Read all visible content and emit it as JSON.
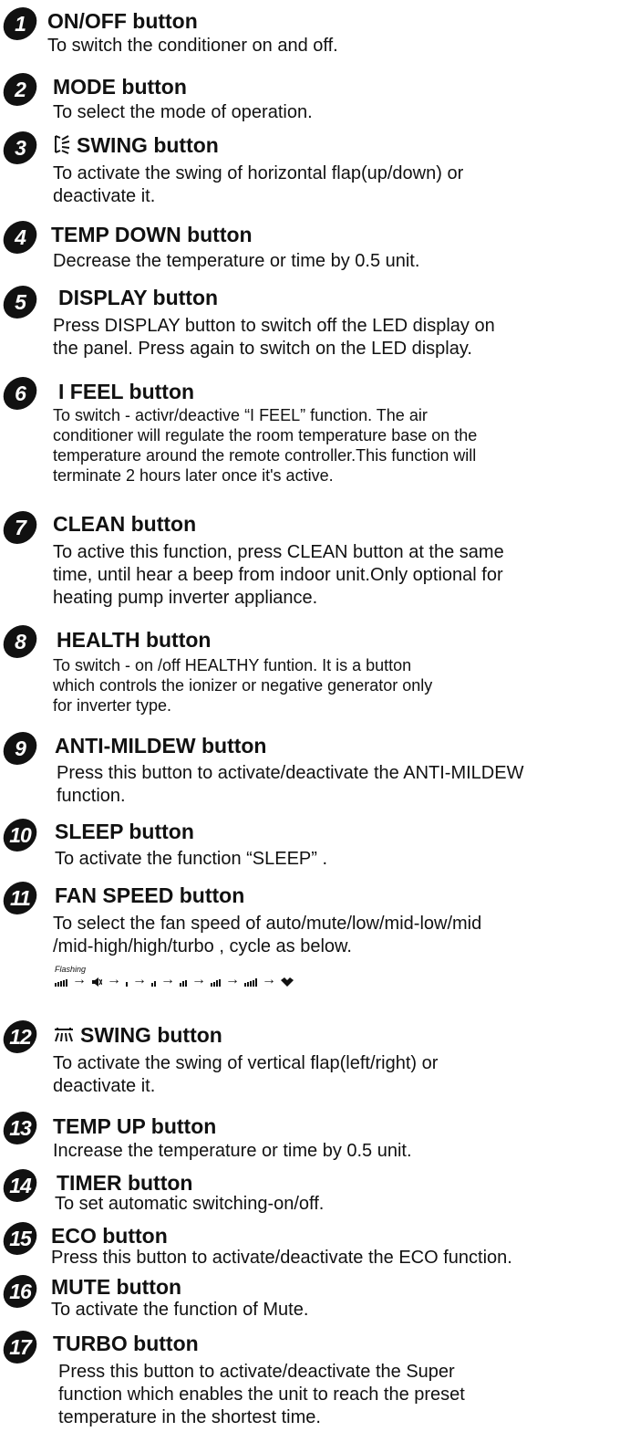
{
  "items": [
    {
      "num": "1",
      "title": "ON/OFF button",
      "lines": [
        "To switch the conditioner on and off."
      ]
    },
    {
      "num": "2",
      "title": "MODE  button",
      "lines": [
        "To select the  mode of operation."
      ]
    },
    {
      "num": "3",
      "title": "SWING  button",
      "lines": [
        "To activate the swing of horizontal flap(up/down) or",
        "deactivate it."
      ]
    },
    {
      "num": "4",
      "title": "TEMP DOWN button",
      "lines": [
        "Decrease the temperature or time by 0.5 unit."
      ]
    },
    {
      "num": "5",
      "title": "DISPLAY  button",
      "lines": [
        "Press   DISPLAY   button to switch off the LED display on",
        "the panel. Press again to switch on the LED display."
      ]
    },
    {
      "num": "6",
      "title": "I FEEL  button",
      "lines": [
        "To switch - activr/deactive “I FEEL” function. The air",
        "conditioner will regulate the room temperature base on the",
        "temperature around the remote controller.This function will",
        "terminate 2 hours later once it's active."
      ]
    },
    {
      "num": "7",
      "title": "CLEAN  button",
      "lines": [
        "To active this function, press  CLEAN  button at the same",
        "time, until hear a beep from indoor unit.Only optional for",
        "heating pump inverter appliance."
      ]
    },
    {
      "num": "8",
      "title": "HEALTH button",
      "lines": [
        "To switch - on /off HEALTHY funtion. It is a button",
        "which controls the ionizer or negative generator only",
        "for inverter type."
      ]
    },
    {
      "num": "9",
      "title": "ANTI-MILDEW button",
      "lines": [
        "Press this button to activate/deactivate the ANTI-MILDEW",
        "function."
      ]
    },
    {
      "num": "10",
      "title": "SLEEP button",
      "lines": [
        "To activate the function  “SLEEP” ."
      ]
    },
    {
      "num": "11",
      "title": "FAN SPEED button",
      "lines": [
        "To select the  fan speed of auto/mute/low/mid-low/mid",
        "/mid-high/high/turbo , cycle as below."
      ],
      "fan_caption": "Flashing"
    },
    {
      "num": "12",
      "title": "SWING  button",
      "lines": [
        "To activate the swing of vertical flap(left/right) or",
        "deactivate it."
      ]
    },
    {
      "num": "13",
      "title": "TEMP UP button",
      "lines": [
        "Increase the temperature or time by 0.5 unit."
      ]
    },
    {
      "num": "14",
      "title": "TIMER  button",
      "lines": [
        "To set  automatic switching-on/off."
      ]
    },
    {
      "num": "15",
      "title": "ECO button",
      "lines": [
        "Press this button to activate/deactivate the ECO function."
      ]
    },
    {
      "num": "16",
      "title": "MUTE  button",
      "lines": [
        "To activate the function of Mute."
      ]
    },
    {
      "num": "17",
      "title": "TURBO  button",
      "lines": [
        "Press this button to activate/deactivate the Super",
        "function which enables the unit to reach the preset",
        "temperature in the shortest time."
      ]
    }
  ]
}
